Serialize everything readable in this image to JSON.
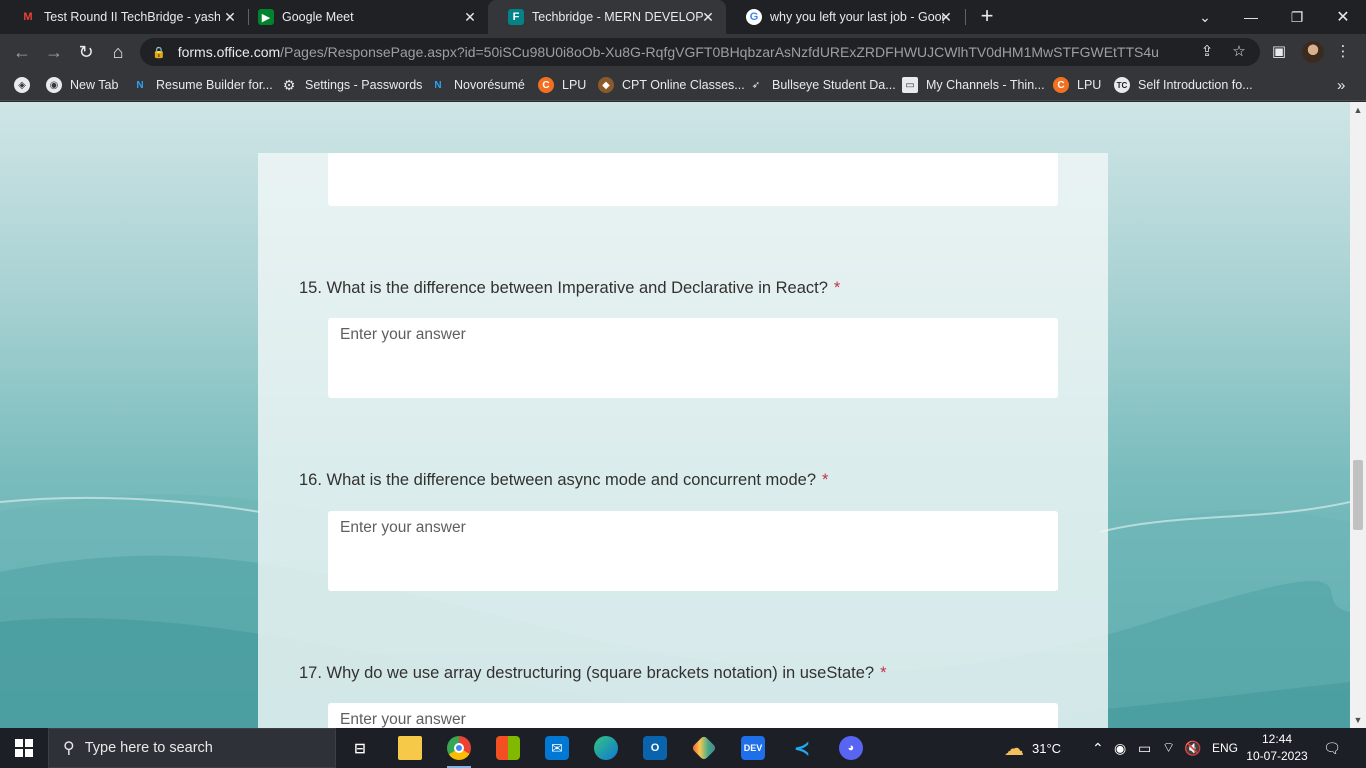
{
  "browser": {
    "tabs": [
      {
        "title": "Test Round II TechBridge - yashol",
        "icon": "gmail-icon",
        "active": false
      },
      {
        "title": "Google Meet",
        "icon": "google-meet-icon",
        "active": false
      },
      {
        "title": "Techbridge - MERN DEVELOPER (",
        "icon": "microsoft-forms-icon",
        "active": true
      },
      {
        "title": "why you left your last job - Goog",
        "icon": "google-icon",
        "active": false
      }
    ],
    "url_host": "forms.office.com",
    "url_path": "/Pages/ResponsePage.aspx?id=50iSCu98U0i8oOb-Xu8G-RqfgVGFT0BHqbzarAsNzfdURExZRDFHWUJCWlhTV0dHM1MwSTFGWEtTTS4u",
    "bookmarks": [
      {
        "label": "New Tab",
        "icon": "globe-icon"
      },
      {
        "label": "Resume Builder for...",
        "icon": "novoresume-icon"
      },
      {
        "label": "Settings - Passwords",
        "icon": "gear-icon"
      },
      {
        "label": "Novorésumé",
        "icon": "novoresume-icon"
      },
      {
        "label": "LPU",
        "icon": "lpu-icon"
      },
      {
        "label": "CPT Online Classes...",
        "icon": "cpt-icon"
      },
      {
        "label": "Bullseye Student Da...",
        "icon": "bullseye-icon"
      },
      {
        "label": "My Channels - Thin...",
        "icon": "chat-icon"
      },
      {
        "label": "LPU",
        "icon": "lpu-icon"
      },
      {
        "label": "Self Introduction fo...",
        "icon": "tc-icon"
      }
    ],
    "bookmarks_more": "»"
  },
  "form": {
    "questions": [
      {
        "number": "15.",
        "text": "What is the difference between Imperative and Declarative in React?",
        "required": "*",
        "placeholder": "Enter your answer"
      },
      {
        "number": "16.",
        "text": "What is the difference between async mode and concurrent mode?",
        "required": "*",
        "placeholder": "Enter your answer"
      },
      {
        "number": "17.",
        "text": "Why do we use array destructuring (square brackets notation) in useState?",
        "required": "*",
        "placeholder": "Enter your answer"
      }
    ]
  },
  "taskbar": {
    "search_placeholder": "Type here to search",
    "apps": [
      "task-view-icon",
      "file-explorer-icon",
      "chrome-icon",
      "microsoft-store-icon",
      "mail-icon",
      "edge-icon",
      "outlook-icon",
      "git-icon",
      "dev-icon",
      "vscode-icon",
      "discord-icon"
    ],
    "weather": "31°C",
    "language": "ENG",
    "time": "12:44",
    "date": "10-07-2023"
  }
}
